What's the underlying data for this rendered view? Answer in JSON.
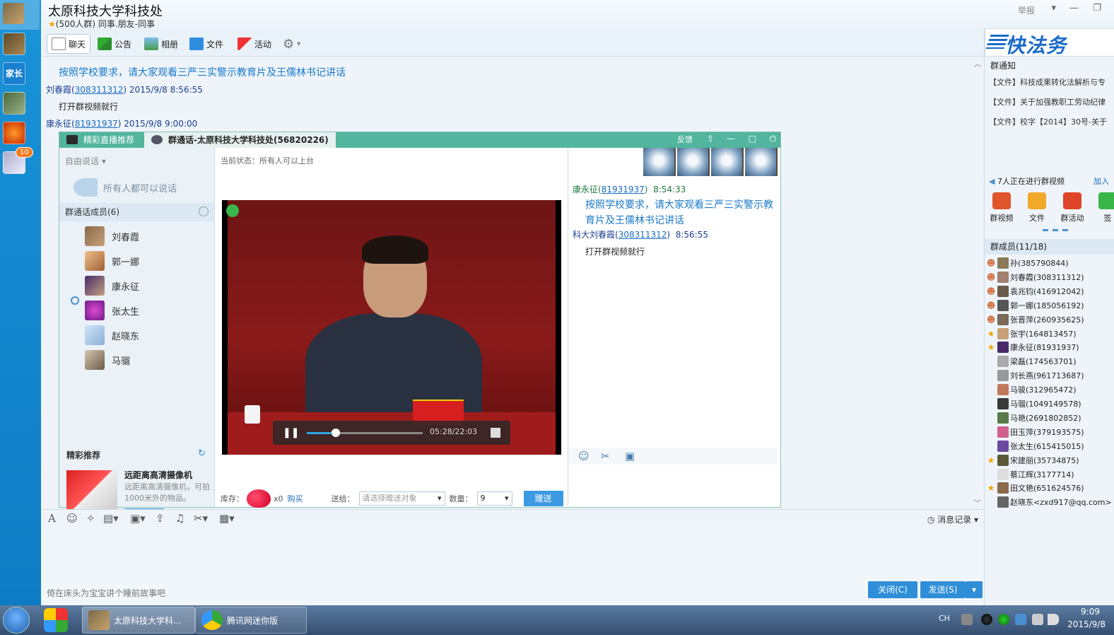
{
  "window": {
    "title": "太原科技大学科技处",
    "subtitle": "(500人群) 同事.朋友-同事",
    "report": "举报",
    "controls": {
      "dropdown": "▾",
      "minimize": "—",
      "restore": "❐"
    }
  },
  "sidebar": {
    "badge": "10"
  },
  "toolbar": {
    "items": [
      {
        "label": "聊天"
      },
      {
        "label": "公告"
      },
      {
        "label": "相册"
      },
      {
        "label": "文件"
      },
      {
        "label": "活动"
      }
    ],
    "settings_icon": "gear-icon"
  },
  "chat": {
    "messages": [
      {
        "body": "按照学校要求，请大家观看三严三实警示教育片及王儒林书记讲话"
      },
      {
        "name": "刘春霞",
        "id": "308311312",
        "time": "2015/9/8 8:56:55",
        "body": "打开群视频就行"
      },
      {
        "name": "康永征",
        "id": "81931937",
        "time": "2015/9/8 9:00:00"
      }
    ]
  },
  "video_window": {
    "tab_live": "精彩直播推荐",
    "tab_call": "群通话-太原科技大学科技处(56820226)",
    "feedback": "反馈",
    "mode": "自由说话",
    "all_can_speak": "所有人都可以说话",
    "members_title": "群通话成员(6)",
    "members": [
      "刘春霞",
      "郭一娜",
      "康永征",
      "张太生",
      "赵晓东",
      "马骝"
    ],
    "recommend_title": "精彩推荐",
    "recommend_item_title": "远距离高清摄像机",
    "recommend_item_desc": "远距离高清摄像机，可拍1000米外的物品。",
    "recommend_enter": "进入",
    "current_state": "当前状态：所有人可以上台",
    "player": {
      "time": "05:28/22:03",
      "progress": 0.249
    },
    "gift": {
      "stock_label": "库存：",
      "count": "x0",
      "buy": "购买",
      "send_to_label": "送给：",
      "send_to_placeholder": "请选择赠送对象",
      "quantity_label": "数量：",
      "quantity": "9",
      "send": "赠送"
    },
    "side_messages": [
      {
        "name": "康永征",
        "id": "81931937",
        "time": "8:54:33",
        "body": "按照学校要求，请大家观看三严三实警示教育片及王儒林书记讲话"
      },
      {
        "name": "科大刘春霞",
        "id": "308311312",
        "time": "8:56:55",
        "body": "打开群视频就行"
      }
    ]
  },
  "input": {
    "message_log": "消息记录",
    "ad_text": "倚在床头为宝宝讲个睡前故事吧",
    "close": "关闭(C)",
    "send": "发送(S)"
  },
  "right_panel": {
    "logo": "快法务",
    "notice_title": "群通知",
    "notices": [
      "【文件】科技成果转化法解析与专",
      "【文件】关于加强教职工劳动纪律",
      "【文件】校字【2014】30号-关于"
    ],
    "video_status": "7人正在进行群视频",
    "video_join": "加入",
    "apps": [
      "群视频",
      "文件",
      "群活动",
      "签"
    ],
    "members_title": "群成员(11/18)",
    "members": [
      {
        "label": "孙(385790844)",
        "role": "user"
      },
      {
        "label": "刘春霞(308311312)",
        "role": "user"
      },
      {
        "label": "袁兆钧(416912042)",
        "role": "user"
      },
      {
        "label": "郭一娜(185056192)",
        "role": "user"
      },
      {
        "label": "张晋萍(260935625)",
        "role": "user"
      },
      {
        "label": "张宇(164813457)",
        "role": "admin"
      },
      {
        "label": "康永征(81931937)",
        "role": "admin"
      },
      {
        "label": "梁磊(174563701)",
        "role": "none"
      },
      {
        "label": "刘长燕(961713687)",
        "role": "none"
      },
      {
        "label": "马骏(312965472)",
        "role": "none"
      },
      {
        "label": "马骝(1049149578)",
        "role": "none"
      },
      {
        "label": "马艳(2691802852)",
        "role": "none"
      },
      {
        "label": "田玉萍(379193575)",
        "role": "none"
      },
      {
        "label": "张太生(615415015)",
        "role": "none"
      },
      {
        "label": "宋建丽(35734875)",
        "role": "admin"
      },
      {
        "label": "蔡江辉(3177714)",
        "role": "none"
      },
      {
        "label": "田文艳(651624576)",
        "role": "admin"
      },
      {
        "label": "赵晓东<zxd917@qq.com>",
        "role": "none"
      }
    ]
  },
  "taskbar": {
    "tasks": [
      "太原科技大学科...",
      "腾讯网迷你版"
    ],
    "lang": "CH",
    "time": "9:09",
    "date": "2015/9/8"
  }
}
